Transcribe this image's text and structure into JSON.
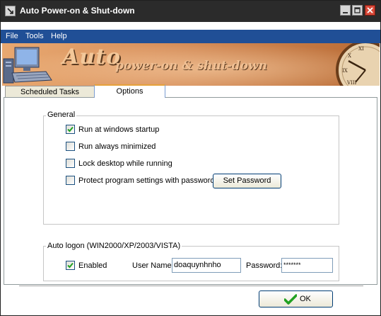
{
  "window": {
    "title": "Auto Power-on & Shut-down"
  },
  "menu": {
    "items": [
      "File",
      "Tools",
      "Help"
    ]
  },
  "banner": {
    "title_line1": "Auto",
    "title_line2": "power-on & shut-down"
  },
  "tabs": [
    {
      "label": "Scheduled Tasks",
      "selected": false
    },
    {
      "label": "Options",
      "selected": true
    }
  ],
  "general": {
    "legend": "General",
    "options": [
      {
        "label": "Run at windows startup",
        "checked": true
      },
      {
        "label": "Run always minimized",
        "checked": false
      },
      {
        "label": "Lock desktop while running",
        "checked": false
      },
      {
        "label": "Protect program settings with password",
        "checked": false
      }
    ],
    "set_password_label": "Set Password"
  },
  "autologon": {
    "legend": "Auto logon (WIN2000/XP/2003/VISTA)",
    "enabled_label": "Enabled",
    "enabled_checked": true,
    "username_label": "User Name:",
    "username_value": "doaquynhnho",
    "password_label": "Password:",
    "password_value": "*******"
  },
  "footer": {
    "ok_label": "OK"
  },
  "colors": {
    "titlebar": "#2b2b2b",
    "menubar": "#204f96",
    "tab_accent": "#e6a23c",
    "check_green": "#21a121"
  },
  "icons": {
    "app": "app-icon",
    "minimize": "minimize-icon",
    "maximize": "maximize-icon",
    "close": "close-icon",
    "ok": "checkmark-icon"
  }
}
